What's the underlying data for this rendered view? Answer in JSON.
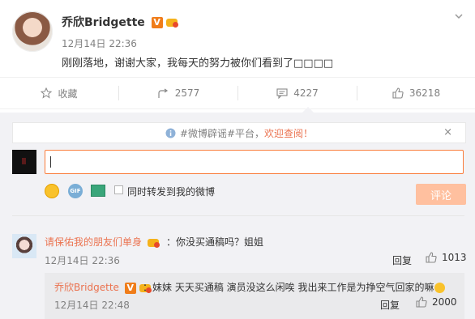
{
  "post": {
    "author": "乔欣Bridgette",
    "verified_badge": "V",
    "time": "12月14日 22:36",
    "text": "刚刚落地，谢谢大家，我每天的努力被你们看到了□□□□"
  },
  "actions": {
    "favorite": "收藏",
    "repost": "2577",
    "comment": "4227",
    "like": "36218"
  },
  "notice": {
    "prefix": "#微博辟谣#平台，",
    "link": "欢迎查阅！",
    "close": "×"
  },
  "composer": {
    "sync_label": "同时转发到我的微博",
    "submit_label": "评论",
    "gif_label": "GIF"
  },
  "comments": [
    {
      "name": "请保佑我的朋友们单身",
      "text": "：你没买通稿吗？姐姐",
      "time": "12月14日 22:36",
      "reply": "回复",
      "likes": "1013"
    }
  ],
  "reply": {
    "name": "乔欣Bridgette",
    "verified_badge": "V",
    "text": "：妹妹 天天买通稿 演员没这么闲唉 我出来工作是为挣空气回家的嘛",
    "time": "12月14日 22:48",
    "reply": "回复",
    "likes": "2000"
  },
  "colors": {
    "accent": "#eb7350",
    "verified": "#f07d1a",
    "submit_disabled": "#ffc09f",
    "panel": "#f2f2f5"
  },
  "icons": [
    "chevron-down-icon",
    "star-icon",
    "repost-icon",
    "comment-icon",
    "thumb-up-icon",
    "info-icon",
    "close-icon",
    "emoji-icon",
    "gif-icon",
    "picture-icon",
    "crown-icon"
  ]
}
